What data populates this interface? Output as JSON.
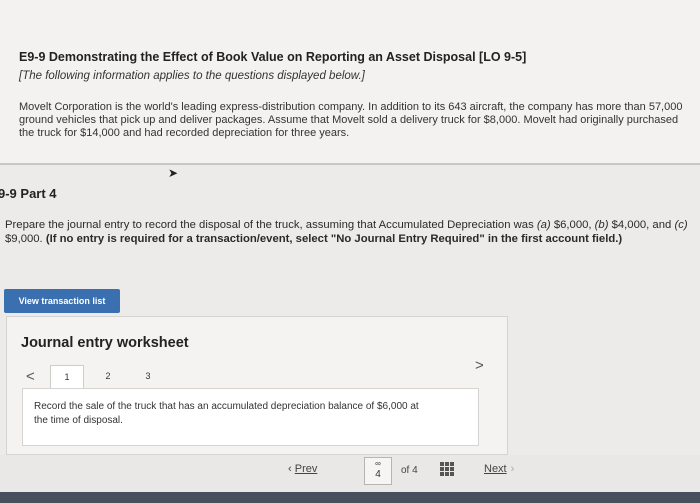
{
  "info": {
    "title": "E9-9 Demonstrating the Effect of Book Value on Reporting an Asset Disposal [LO 9-5]",
    "note": "[The following information applies to the questions displayed below.]",
    "body": "Movelt Corporation is the world's leading express-distribution company. In addition to its 643 aircraft, the company has more than 57,000 ground vehicles that pick up and deliver packages. Assume that Movelt sold a delivery truck for $8,000. Movelt had originally purchased the truck for $14,000 and had recorded depreciation for three years."
  },
  "part": {
    "title": "9-9 Part 4",
    "instr_text": "Prepare the journal entry to record the disposal of the truck, assuming that Accumulated Depreciation was ",
    "a_label": "(a)",
    "a_value": " $6,000, ",
    "b_label": "(b)",
    "b_value": " $4,000, and ",
    "c_label": "(c)",
    "c_value": " $9,000. ",
    "instr_bold": "(If no entry is required for a transaction/event, select \"No Journal Entry Required\" in the first account field.)"
  },
  "view_button_label": "View transaction list",
  "worksheet": {
    "title": "Journal entry worksheet",
    "tabs": [
      "1",
      "2",
      "3"
    ],
    "prev_icon": "<",
    "next_icon": ">",
    "prompt": "Record the sale of the truck that has an accumulated depreciation balance of $6,000 at the time of disposal."
  },
  "pager": {
    "prev_label": "Prev",
    "current_page": "4",
    "of_text": "of 4",
    "next_label": "Next",
    "link_icon": "link-icon",
    "grid_icon": "grid-icon"
  }
}
